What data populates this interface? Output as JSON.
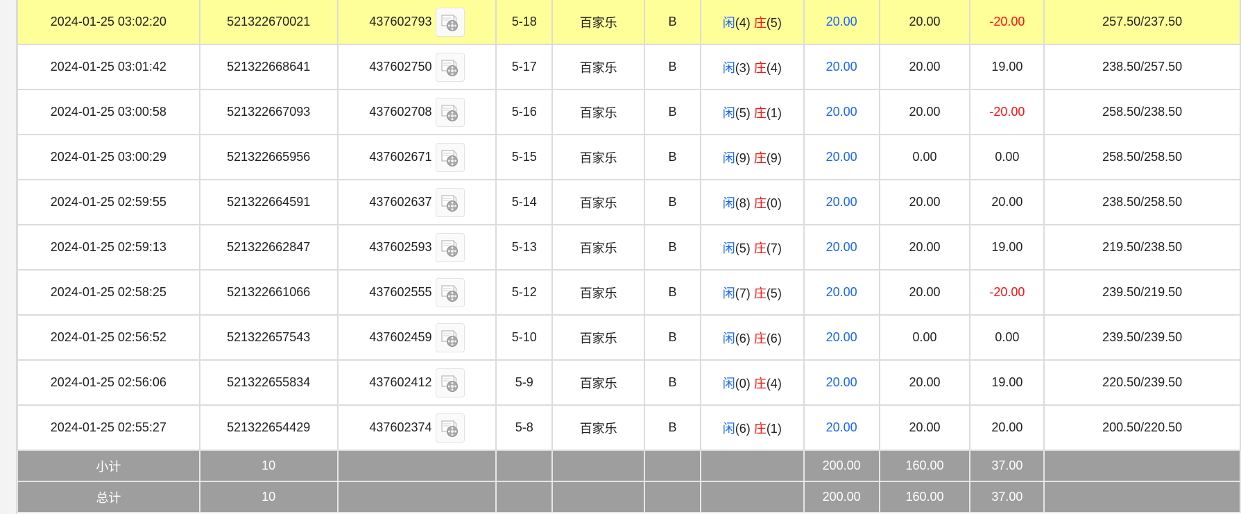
{
  "table": {
    "rows": [
      {
        "time": "2024-01-25 03:02:20",
        "order_no": "521322670021",
        "bet_no": "437602793",
        "round": "5-18",
        "game": "百家乐",
        "table": "B",
        "player_label": "闲",
        "player_val": "(4)",
        "banker_label": "庄",
        "banker_val": "(5)",
        "bet": "20.00",
        "valid": "20.00",
        "win": "-20.00",
        "win_negative": true,
        "balance": "257.50/237.50",
        "highlight": true
      },
      {
        "time": "2024-01-25 03:01:42",
        "order_no": "521322668641",
        "bet_no": "437602750",
        "round": "5-17",
        "game": "百家乐",
        "table": "B",
        "player_label": "闲",
        "player_val": "(3)",
        "banker_label": "庄",
        "banker_val": "(4)",
        "bet": "20.00",
        "valid": "20.00",
        "win": "19.00",
        "win_negative": false,
        "balance": "238.50/257.50",
        "highlight": false
      },
      {
        "time": "2024-01-25 03:00:58",
        "order_no": "521322667093",
        "bet_no": "437602708",
        "round": "5-16",
        "game": "百家乐",
        "table": "B",
        "player_label": "闲",
        "player_val": "(5)",
        "banker_label": "庄",
        "banker_val": "(1)",
        "bet": "20.00",
        "valid": "20.00",
        "win": "-20.00",
        "win_negative": true,
        "balance": "258.50/238.50",
        "highlight": false
      },
      {
        "time": "2024-01-25 03:00:29",
        "order_no": "521322665956",
        "bet_no": "437602671",
        "round": "5-15",
        "game": "百家乐",
        "table": "B",
        "player_label": "闲",
        "player_val": "(9)",
        "banker_label": "庄",
        "banker_val": "(9)",
        "bet": "20.00",
        "valid": "0.00",
        "win": "0.00",
        "win_negative": false,
        "balance": "258.50/258.50",
        "highlight": false
      },
      {
        "time": "2024-01-25 02:59:55",
        "order_no": "521322664591",
        "bet_no": "437602637",
        "round": "5-14",
        "game": "百家乐",
        "table": "B",
        "player_label": "闲",
        "player_val": "(8)",
        "banker_label": "庄",
        "banker_val": "(0)",
        "bet": "20.00",
        "valid": "20.00",
        "win": "20.00",
        "win_negative": false,
        "balance": "238.50/258.50",
        "highlight": false
      },
      {
        "time": "2024-01-25 02:59:13",
        "order_no": "521322662847",
        "bet_no": "437602593",
        "round": "5-13",
        "game": "百家乐",
        "table": "B",
        "player_label": "闲",
        "player_val": "(5)",
        "banker_label": "庄",
        "banker_val": "(7)",
        "bet": "20.00",
        "valid": "20.00",
        "win": "19.00",
        "win_negative": false,
        "balance": "219.50/238.50",
        "highlight": false
      },
      {
        "time": "2024-01-25 02:58:25",
        "order_no": "521322661066",
        "bet_no": "437602555",
        "round": "5-12",
        "game": "百家乐",
        "table": "B",
        "player_label": "闲",
        "player_val": "(7)",
        "banker_label": "庄",
        "banker_val": "(5)",
        "bet": "20.00",
        "valid": "20.00",
        "win": "-20.00",
        "win_negative": true,
        "balance": "239.50/219.50",
        "highlight": false
      },
      {
        "time": "2024-01-25 02:56:52",
        "order_no": "521322657543",
        "bet_no": "437602459",
        "round": "5-10",
        "game": "百家乐",
        "table": "B",
        "player_label": "闲",
        "player_val": "(6)",
        "banker_label": "庄",
        "banker_val": "(6)",
        "bet": "20.00",
        "valid": "0.00",
        "win": "0.00",
        "win_negative": false,
        "balance": "239.50/239.50",
        "highlight": false
      },
      {
        "time": "2024-01-25 02:56:06",
        "order_no": "521322655834",
        "bet_no": "437602412",
        "round": "5-9",
        "game": "百家乐",
        "table": "B",
        "player_label": "闲",
        "player_val": "(0)",
        "banker_label": "庄",
        "banker_val": "(4)",
        "bet": "20.00",
        "valid": "20.00",
        "win": "19.00",
        "win_negative": false,
        "balance": "220.50/239.50",
        "highlight": false
      },
      {
        "time": "2024-01-25 02:55:27",
        "order_no": "521322654429",
        "bet_no": "437602374",
        "round": "5-8",
        "game": "百家乐",
        "table": "B",
        "player_label": "闲",
        "player_val": "(6)",
        "banker_label": "庄",
        "banker_val": "(1)",
        "bet": "20.00",
        "valid": "20.00",
        "win": "20.00",
        "win_negative": false,
        "balance": "200.50/220.50",
        "highlight": false
      }
    ],
    "subtotal": {
      "label": "小计",
      "count": "10",
      "bet": "200.00",
      "valid": "160.00",
      "win": "37.00"
    },
    "total": {
      "label": "总计",
      "count": "10",
      "bet": "200.00",
      "valid": "160.00",
      "win": "37.00"
    }
  },
  "icons": {
    "replay": "video-replay-icon"
  },
  "colors": {
    "highlight": "#ffff99",
    "player": "#1a66ff",
    "banker": "#ff1010",
    "negative": "#ff1010",
    "bet": "#1a66ff",
    "total_bg": "#9e9e9e"
  }
}
